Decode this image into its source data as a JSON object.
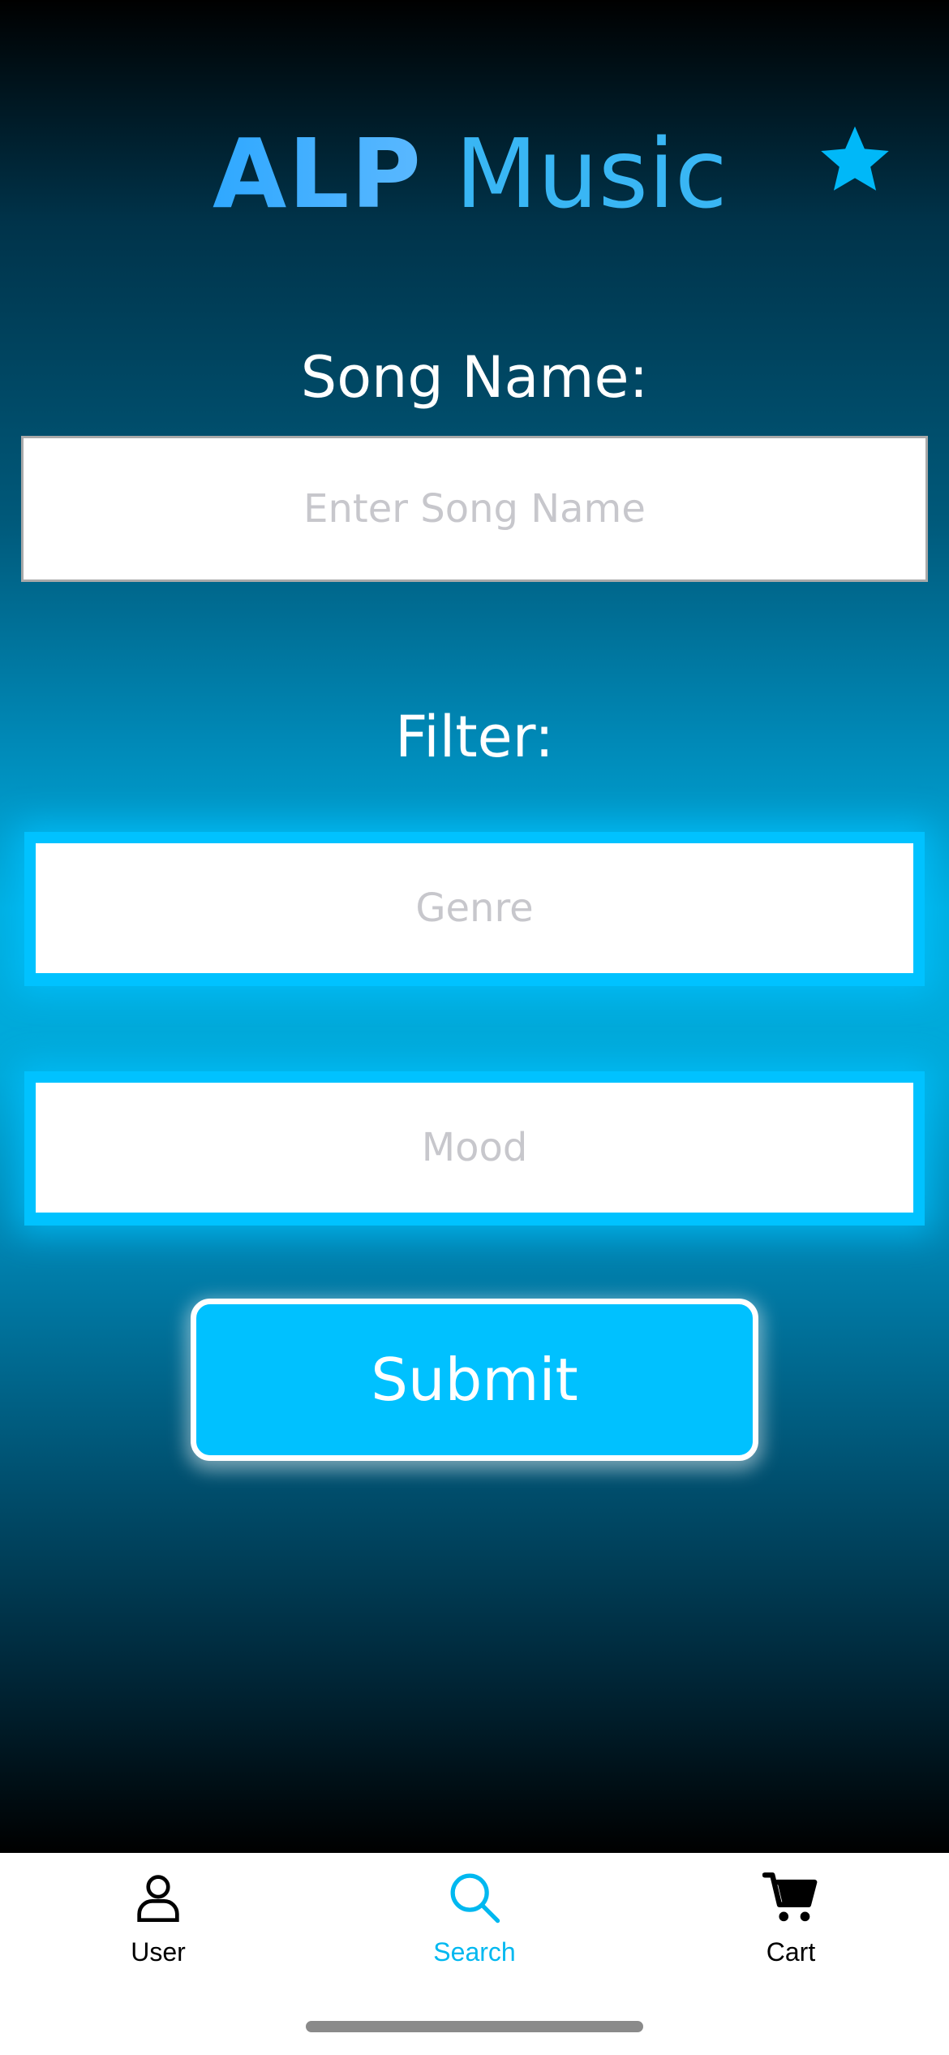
{
  "app": {
    "logo_bold": "ALP",
    "logo_light": "Music",
    "star_icon": "star-icon"
  },
  "form": {
    "song_label": "Song Name:",
    "song_placeholder": "Enter Song Name",
    "filter_label": "Filter:",
    "genre_placeholder": "Genre",
    "mood_placeholder": "Mood",
    "submit_label": "Submit"
  },
  "tabbar": {
    "items": [
      {
        "label": "User",
        "icon": "user-icon",
        "active": false
      },
      {
        "label": "Search",
        "icon": "search-icon",
        "active": true
      },
      {
        "label": "Cart",
        "icon": "cart-icon",
        "active": false
      }
    ]
  },
  "colors": {
    "accent": "#00c1ff",
    "active_tab": "#00b8f0",
    "logo_blue": "#39b6f4"
  }
}
